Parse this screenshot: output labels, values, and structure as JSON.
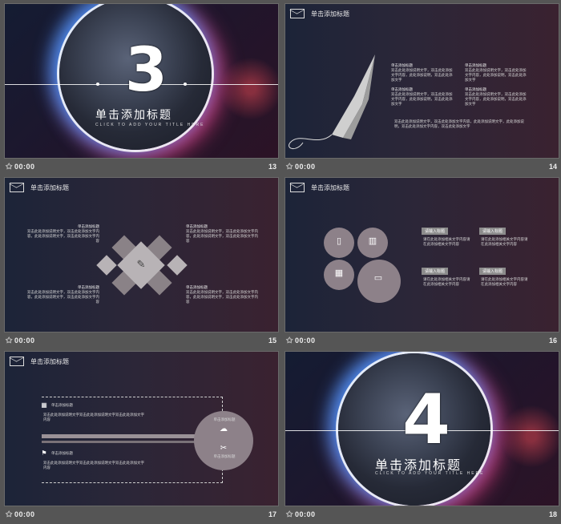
{
  "slides": [
    {
      "title": "单击添加标题",
      "subtitle": "CLICK TO ADD YOUR TITLE HERE",
      "big_number": "3",
      "time": "00:00",
      "num": "13"
    },
    {
      "header": "单击添加标题",
      "bullet_title": "单击添加标题",
      "bullet_text": "双击此处添加说明文字，双击此处添加文字内容，此处添加说明，双击此处添加文字",
      "para": "双击此处添加说明文字，双击此处添加文字内容，此处添加说明文字，此处添加说明，双击此处添加文字内容，双击此处添加文字",
      "time": "00:00",
      "num": "14"
    },
    {
      "header": "单击添加标题",
      "block_title": "单击添加标题",
      "block_text": "双击此处添加说明文字，双击此处添加文字内容，此处添加说明文字，双击此处添加文字内容",
      "time": "00:00",
      "num": "15"
    },
    {
      "header": "单击添加标题",
      "tag": "请输入标题",
      "tag_text": "请在此处添加相关文字内容请在此添加相关文字内容",
      "time": "00:00",
      "num": "16"
    },
    {
      "header": "单击添加标题",
      "row_title": "单击添加标题",
      "row_text": "双击此处添加说明文字双击此处添加说明文字双击此处添加文字内容",
      "circle_label": "单击添加标题",
      "time": "00:00",
      "num": "17"
    },
    {
      "title": "单击添加标题",
      "subtitle": "CLICK TO ADD YOUR TITLE HERE",
      "big_number": "4",
      "time": "00:00",
      "num": "18"
    }
  ]
}
